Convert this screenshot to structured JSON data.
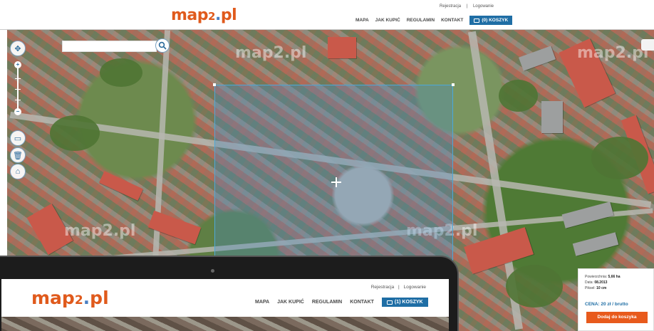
{
  "header": {
    "logo_main": "map",
    "logo_two": "2",
    "logo_dot": ".",
    "logo_tld": "pl",
    "register_label": "Rejestracja",
    "separator": "|",
    "login_label": "Logowanie",
    "nav": [
      "MAPA",
      "JAK KUPIĆ",
      "REGULAMIN",
      "KONTAKT"
    ],
    "cart_label": "(0) KOSZYK"
  },
  "map": {
    "watermarks": [
      "map2.pl",
      "map2.pl",
      "map2.pl",
      "map2.pl"
    ],
    "search_placeholder": ""
  },
  "info_panel": {
    "area_label": "Powierzchnia:",
    "area_value": "5,66 ha",
    "date_label": "Data:",
    "date_value": "08.2013",
    "pixel_label": "Piksel:",
    "pixel_value": "10 cm",
    "price_label": "CENA: 20 zł / brutto",
    "add_button": "Dodaj do koszyka"
  },
  "laptop": {
    "register_label": "Rejestracja",
    "separator": "|",
    "login_label": "Logowanie",
    "nav": [
      "MAPA",
      "JAK KUPIĆ",
      "REGULAMIN",
      "KONTAKT"
    ],
    "cart_label": "(1) KOSZYK"
  }
}
